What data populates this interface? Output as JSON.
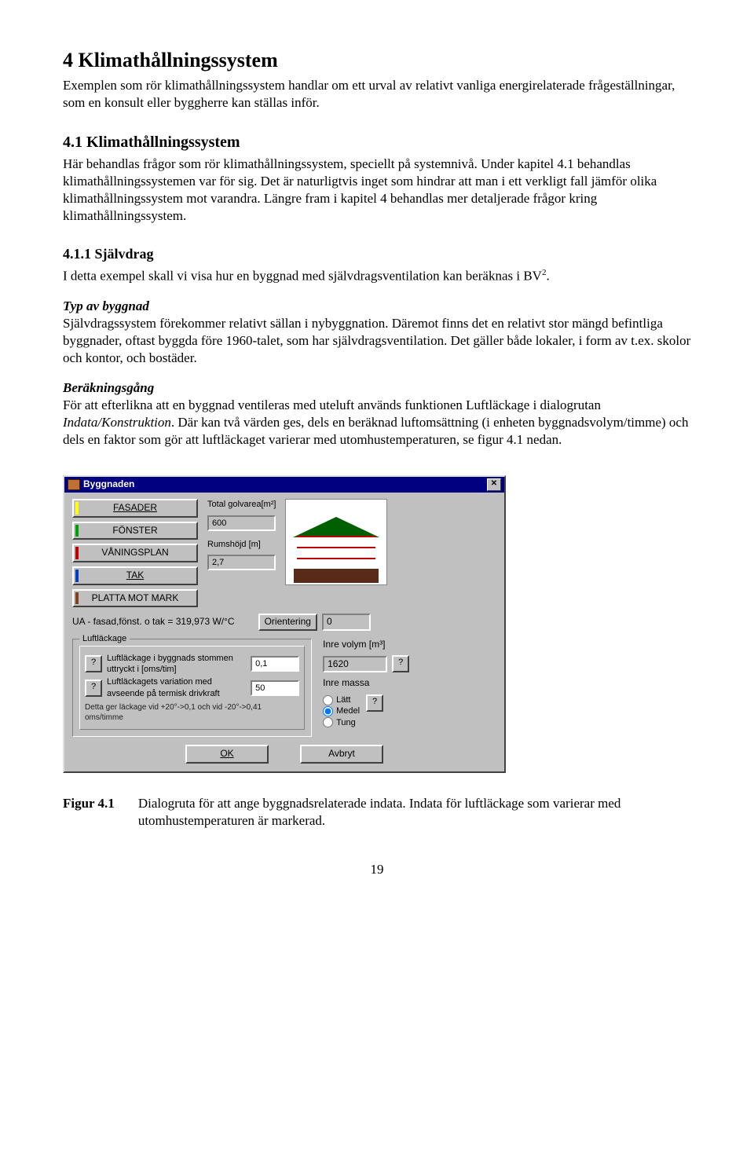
{
  "h1": "4 Klimathållningssystem",
  "p1": "Exemplen som rör klimathållningssystem handlar om ett urval av relativt vanliga energirelaterade frågeställningar, som en konsult eller byggherre kan ställas inför.",
  "h2": "4.1 Klimathållningssystem",
  "p2": "Här behandlas frågor som rör klimathållningssystem, speciellt på systemnivå. Under kapitel 4.1 behandlas klimathållningssystemen var för sig. Det är naturligtvis inget som hindrar att man i ett verkligt fall jämför olika klimathållningssystem mot varandra. Längre fram i kapitel 4 behandlas mer detaljerade frågor kring klimathållningssystem.",
  "h3": "4.1.1 Självdrag",
  "p3a": "I detta exempel skall vi visa hur en byggnad med självdragsventilation kan beräknas i BV",
  "p3b": ".",
  "sup2": "2",
  "typhead": "Typ av byggnad",
  "p4": "Självdragssystem förekommer relativt sällan i nybyggnation. Däremot finns det en relativt stor mängd befintliga byggnader, oftast byggda före 1960-talet, som har självdragsventilation. Det gäller både lokaler, i form av t.ex. skolor och kontor, och bostäder.",
  "berhead": "Beräkningsgång",
  "p5a": "För att efterlikna att en byggnad ventileras med uteluft används funktionen Luftläckage i dialogrutan ",
  "p5ital": "Indata/Konstruktion",
  "p5b": ". Där kan två värden ges, dels en beräknad luftomsättning (i enheten byggnadsvolym/timme) och dels en faktor som gör att luftläckaget varierar med utomhustemperaturen, se figur 4.1 nedan.",
  "dialog": {
    "title": "Byggnaden",
    "btns": {
      "fasader": "FASADER",
      "fonster": "FÖNSTER",
      "vaning": "VÅNINGSPLAN",
      "tak": "TAK",
      "platta": "PLATTA MOT MARK"
    },
    "total_golv_label": "Total golvarea[m²]",
    "total_golv_val": "600",
    "rumshojd_label": "Rumshöjd [m]",
    "rumshojd_val": "2,7",
    "ua_text": "UA - fasad,fönst. o tak = 319,973 W/°C",
    "orient_label": "Orientering",
    "orient_val": "0",
    "inre_volym_label": "Inre volym [m³]",
    "inre_volym_val": "1620",
    "inre_massa_label": "Inre massa",
    "mass_latt": "Lätt",
    "mass_medel": "Medel",
    "mass_tung": "Tung",
    "leak_legend": "Luftläckage",
    "leak1_label": "Luftläckage i byggnads stommen uttryckt i [oms/tim]",
    "leak1_val": "0,1",
    "leak2_label": "Luftläckagets variation med avseende på termisk drivkraft",
    "leak2_val": "50",
    "leak_note": "Detta ger läckage vid +20°->0,1 och vid -20°->0,41 oms/timme",
    "ok": "OK",
    "avbryt": "Avbryt",
    "q": "?"
  },
  "fig_label": "Figur 4.1",
  "fig_text": "Dialogruta för att ange byggnadsrelaterade indata. Indata för luftläckage som varierar med utomhustemperaturen är markerad.",
  "pagenum": "19"
}
